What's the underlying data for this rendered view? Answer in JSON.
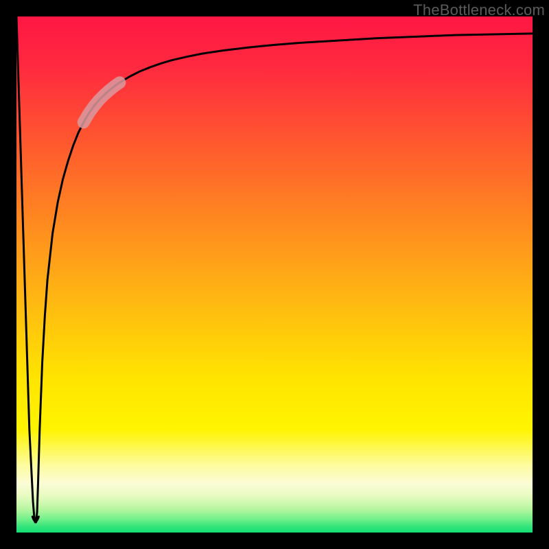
{
  "watermark": "TheBottleneck.com",
  "gradient": {
    "stops": [
      {
        "offset": 0.0,
        "color": "#ff1744"
      },
      {
        "offset": 0.1,
        "color": "#ff2a3f"
      },
      {
        "offset": 0.25,
        "color": "#ff5a2e"
      },
      {
        "offset": 0.4,
        "color": "#ff8a1f"
      },
      {
        "offset": 0.55,
        "color": "#ffb812"
      },
      {
        "offset": 0.7,
        "color": "#ffe400"
      },
      {
        "offset": 0.8,
        "color": "#fff400"
      },
      {
        "offset": 0.87,
        "color": "#fdfca0"
      },
      {
        "offset": 0.905,
        "color": "#fbfcd6"
      },
      {
        "offset": 0.93,
        "color": "#e6fbc0"
      },
      {
        "offset": 0.955,
        "color": "#b6f6a0"
      },
      {
        "offset": 0.975,
        "color": "#6eef89"
      },
      {
        "offset": 0.99,
        "color": "#2fe37a"
      },
      {
        "offset": 1.0,
        "color": "#13df74"
      }
    ]
  },
  "highlight_band": {
    "color": "#d99aa0",
    "opacity": 0.85,
    "width": 18
  },
  "chart_data": {
    "type": "line",
    "title": "",
    "xlabel": "",
    "ylabel": "",
    "xlim": [
      0,
      100
    ],
    "ylim": [
      0,
      100
    ],
    "x": [
      0.0,
      0.5,
      1.0,
      1.5,
      2.0,
      2.5,
      3.0,
      3.2,
      3.4,
      3.6,
      3.8,
      4.0,
      4.2,
      4.5,
      5.0,
      5.5,
      6.0,
      7.0,
      8.0,
      9.0,
      10.0,
      11.0,
      12.0,
      13.0,
      14.0,
      15.0,
      16.0,
      17.0,
      18.0,
      19.0,
      20.0,
      22.0,
      24.0,
      26.0,
      28.0,
      30.0,
      33.0,
      36.0,
      40.0,
      45.0,
      50.0,
      55.0,
      60.0,
      65.0,
      70.0,
      75.0,
      80.0,
      85.0,
      90.0,
      95.0,
      100.0
    ],
    "y": [
      100.0,
      84.0,
      68.0,
      52.0,
      36.0,
      20.0,
      10.0,
      6.0,
      3.5,
      2.0,
      2.0,
      4.0,
      10.0,
      20.0,
      33.0,
      42.0,
      49.0,
      58.0,
      64.0,
      68.5,
      72.0,
      75.0,
      77.5,
      79.5,
      81.2,
      82.6,
      83.8,
      84.8,
      85.7,
      86.5,
      87.2,
      88.4,
      89.4,
      90.2,
      90.9,
      91.5,
      92.2,
      92.8,
      93.4,
      94.0,
      94.5,
      94.9,
      95.2,
      95.5,
      95.8,
      96.0,
      96.2,
      96.4,
      96.5,
      96.6,
      96.7
    ],
    "highlight_segment": {
      "x_start": 13.0,
      "x_end": 20.0
    },
    "notch_bottom": {
      "x_center": 3.7,
      "y_min": 2.0,
      "half_width": 0.6
    }
  }
}
